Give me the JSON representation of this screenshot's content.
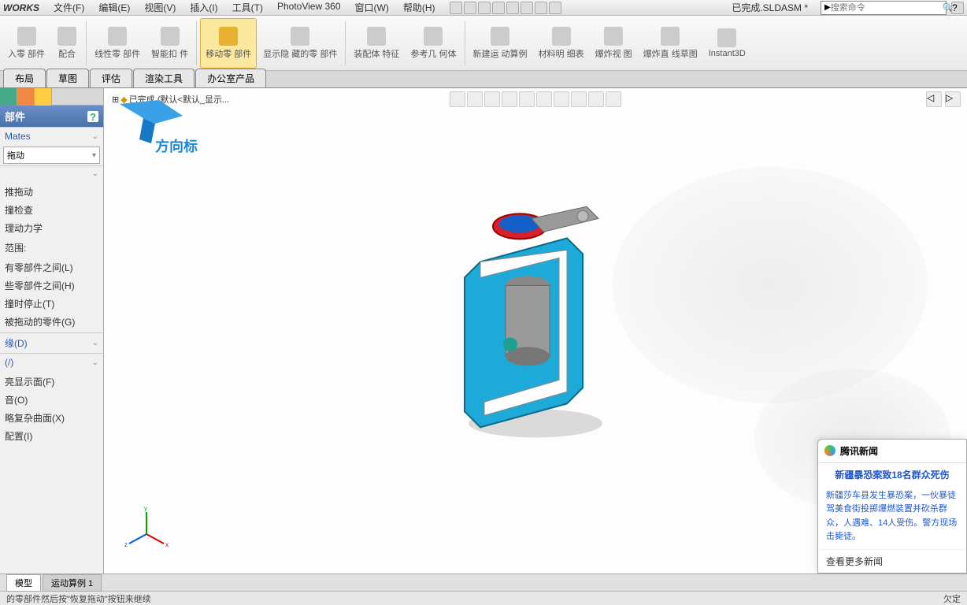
{
  "app": {
    "title": "WORKS",
    "docname": "已完成.SLDASM *"
  },
  "menus": [
    "文件(F)",
    "编辑(E)",
    "视图(V)",
    "插入(I)",
    "工具(T)",
    "PhotoView 360",
    "窗口(W)",
    "帮助(H)"
  ],
  "search": {
    "placeholder": "搜索命令"
  },
  "ribbon": [
    {
      "label": "入零\n部件"
    },
    {
      "label": "配合"
    },
    {
      "sep": true
    },
    {
      "label": "线性零\n部件"
    },
    {
      "label": "智能扣\n件"
    },
    {
      "sep": true
    },
    {
      "label": "移动零\n部件",
      "active": true
    },
    {
      "label": "显示隐\n藏的零\n部件"
    },
    {
      "sep": true
    },
    {
      "label": "装配体\n特征"
    },
    {
      "label": "参考几\n何体"
    },
    {
      "sep": true
    },
    {
      "label": "新建运\n动算例"
    },
    {
      "label": "材料明\n细表"
    },
    {
      "label": "爆炸视\n图"
    },
    {
      "label": "爆炸直\n线草图"
    },
    {
      "label": "Instant3D"
    }
  ],
  "tabs": [
    "布局",
    "草图",
    "评估",
    "渲染工具",
    "办公室产品"
  ],
  "panel": {
    "title": "部件",
    "section_mates": "Mates",
    "dropdown_value": "拖动",
    "options_a": [
      "推拖动",
      "撞检查",
      "理动力学"
    ],
    "range_label": "范围:",
    "options_b": [
      "有零部件之间(L)",
      "些零部件之间(H)",
      "撞时停止(T)",
      "被拖动的零件(G)"
    ],
    "section_d": "缘(D)",
    "section_n": "(/)",
    "options_c": [
      "亮显示面(F)",
      "音(O)",
      "略复杂曲面(X)",
      "配置(I)"
    ]
  },
  "tree": {
    "root": "已完成  (默认<默认_显示..."
  },
  "logo_text": "方向标",
  "bottom_tabs": [
    "模型",
    "运动算例 1"
  ],
  "status": {
    "left": "的零部件然后按\"恢复拖动\"按钮来继续",
    "right": "欠定"
  },
  "news": {
    "source": "腾讯新闻",
    "title": "新疆暴恐案致18名群众死伤",
    "body": "新疆莎车县发生暴恐案，一伙暴徒驾美食街投掷爆燃装置并砍杀群众，人遇难、14人受伤。警方现场击毙徒。",
    "more": "查看更多新闻"
  }
}
